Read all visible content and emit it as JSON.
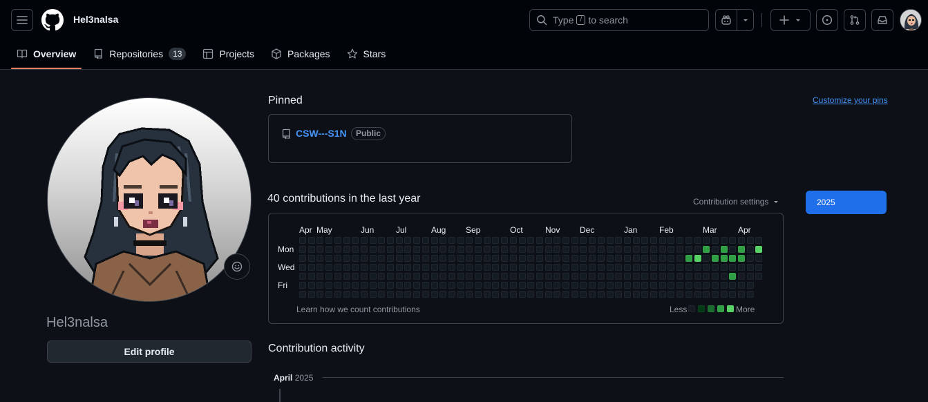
{
  "header": {
    "username": "Hel3nalsa",
    "search": {
      "before": "Type",
      "slash": "/",
      "after": "to search"
    }
  },
  "tabs": [
    {
      "label": "Overview",
      "icon": "book-icon",
      "active": true
    },
    {
      "label": "Repositories",
      "icon": "repo-icon",
      "count": "13"
    },
    {
      "label": "Projects",
      "icon": "table-icon"
    },
    {
      "label": "Packages",
      "icon": "package-icon"
    },
    {
      "label": "Stars",
      "icon": "star-icon"
    }
  ],
  "profile": {
    "name": "Hel3nalsa",
    "edit_label": "Edit profile"
  },
  "pinned": {
    "title": "Pinned",
    "customize_label": "Customize your pins",
    "repos": [
      {
        "name": "CSW---S1N",
        "visibility": "Public"
      }
    ]
  },
  "contributions": {
    "title": "40 contributions in the last year",
    "settings_label": "Contribution settings",
    "year": "2025",
    "months": [
      "Apr",
      "May",
      "Jun",
      "Jul",
      "Aug",
      "Sep",
      "Oct",
      "Nov",
      "Dec",
      "Jan",
      "Feb",
      "Mar",
      "Apr"
    ],
    "days": [
      "Mon",
      "Wed",
      "Fri"
    ],
    "learn_label": "Learn how we count contributions",
    "legend_less": "Less",
    "legend_more": "More",
    "colors": {
      "level0": "#151b23",
      "level1": "#033a16",
      "level2": "#196c2e",
      "level3": "#2ea043",
      "level4": "#56d364"
    },
    "active_cells": [
      {
        "week": 46,
        "day": 1,
        "level": 3
      },
      {
        "week": 48,
        "day": 1,
        "level": 3
      },
      {
        "week": 50,
        "day": 1,
        "level": 3
      },
      {
        "week": 52,
        "day": 1,
        "level": 4
      },
      {
        "week": 44,
        "day": 2,
        "level": 3
      },
      {
        "week": 45,
        "day": 2,
        "level": 4
      },
      {
        "week": 47,
        "day": 2,
        "level": 3
      },
      {
        "week": 48,
        "day": 2,
        "level": 3
      },
      {
        "week": 49,
        "day": 2,
        "level": 3
      },
      {
        "week": 50,
        "day": 2,
        "level": 3
      },
      {
        "week": 49,
        "day": 4,
        "level": 3
      }
    ],
    "last_week_days": 5
  },
  "activity": {
    "title": "Contribution activity",
    "month": "April",
    "year": "2025"
  }
}
